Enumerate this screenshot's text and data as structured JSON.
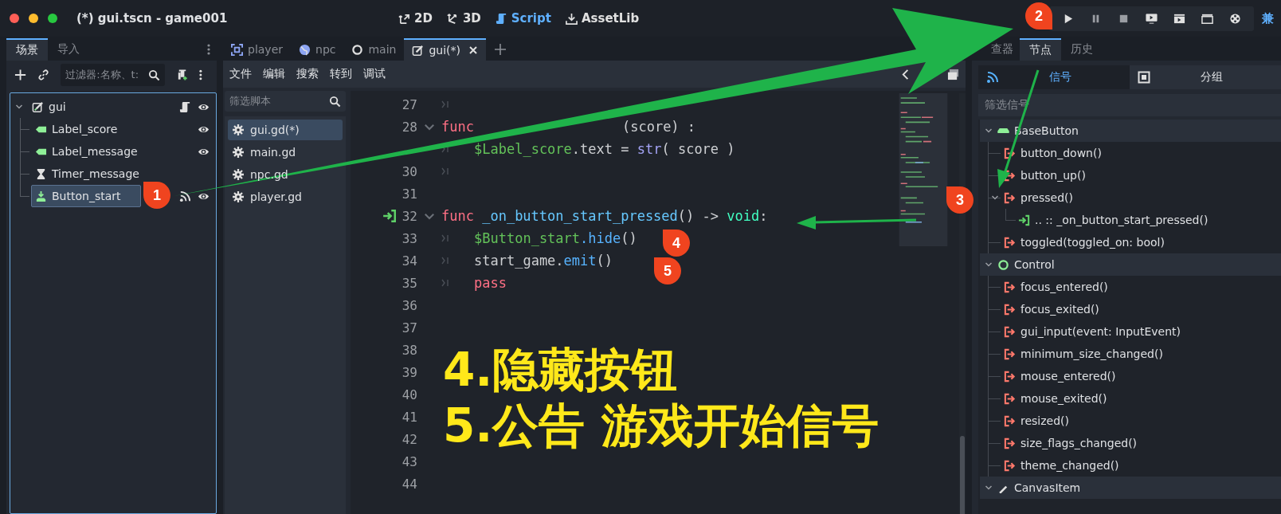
{
  "window": {
    "title": "(*) gui.tscn - game001"
  },
  "main_tabs": [
    {
      "label": "2D",
      "kind": "flat",
      "selected": false
    },
    {
      "label": "3D",
      "kind": "spatial",
      "selected": false
    },
    {
      "label": "Script",
      "kind": "script",
      "selected": true
    },
    {
      "label": "AssetLib",
      "kind": "assetlib",
      "selected": false
    }
  ],
  "renderer_label": "兼",
  "scene_dock": {
    "tabs": [
      {
        "label": "场景",
        "selected": true
      },
      {
        "label": "导入",
        "selected": false
      }
    ],
    "filter": {
      "placeholder": "过滤器:名称、t:"
    },
    "tree": {
      "label": "gui",
      "kind": "control",
      "selected": false,
      "script": true,
      "signals": false,
      "eye": true,
      "children": [
        {
          "label": "Label_score",
          "kind": "label",
          "selected": false,
          "script": false,
          "signals": false,
          "eye": true
        },
        {
          "label": "Label_message",
          "kind": "label",
          "selected": false,
          "script": false,
          "signals": false,
          "eye": true
        },
        {
          "label": "Timer_message",
          "kind": "timer",
          "selected": false,
          "script": false,
          "signals": false,
          "eye": false
        },
        {
          "label": "Button_start",
          "kind": "button",
          "selected": true,
          "script": false,
          "signals": true,
          "eye": true
        }
      ]
    }
  },
  "script_tabs": [
    {
      "label": "player",
      "kind": "node2d",
      "selected": false
    },
    {
      "label": "npc",
      "kind": "globe",
      "selected": false
    },
    {
      "label": "main",
      "kind": "node",
      "selected": false
    },
    {
      "label": "gui(*)",
      "kind": "control",
      "selected": true
    }
  ],
  "editor_menu": [
    "文件",
    "编辑",
    "搜索",
    "转到",
    "调试"
  ],
  "script_filter": {
    "placeholder": "筛选脚本"
  },
  "scripts": [
    {
      "name": "gui.gd(*)",
      "selected": true
    },
    {
      "name": "main.gd",
      "selected": false
    },
    {
      "name": "npc.gd",
      "selected": false
    },
    {
      "name": "player.gd",
      "selected": false
    }
  ],
  "code_lines": [
    {
      "number": "27",
      "fold": false,
      "connected": false,
      "tab": true
    },
    {
      "number": "28",
      "fold": true,
      "connected": false,
      "tab": false,
      "tokens": [
        {
          "kind": "keyword",
          "text": "func"
        },
        {
          "kind": "plain",
          "text": "(score) :",
          "after_gap": true
        }
      ]
    },
    {
      "fold": false,
      "connected": false,
      "tab": true,
      "tokens": [
        {
          "kind": "path",
          "text": "$Label_score"
        },
        {
          "kind": "plain",
          "text": ".text = "
        },
        {
          "kind": "builtin",
          "text": "str"
        },
        {
          "kind": "plain",
          "text": "( score )"
        }
      ]
    },
    {
      "number": "30",
      "fold": false,
      "connected": false,
      "tab": true
    },
    {
      "number": "31",
      "fold": false,
      "connected": false,
      "tab": false
    },
    {
      "number": "32",
      "fold": true,
      "connected": true,
      "tab": false,
      "tokens": [
        {
          "kind": "keyword",
          "text": "func"
        },
        {
          "kind": "function",
          "text": " _on_button_start_pressed"
        },
        {
          "kind": "plain",
          "text": "() -> "
        },
        {
          "kind": "type",
          "text": "void"
        },
        {
          "kind": "plain",
          "text": ":"
        }
      ]
    },
    {
      "number": "33",
      "fold": false,
      "connected": false,
      "tab": true,
      "tokens": [
        {
          "kind": "path",
          "text": "$Button_start"
        },
        {
          "kind": "method",
          "text": ".hide"
        },
        {
          "kind": "plain",
          "text": "()"
        }
      ]
    },
    {
      "number": "34",
      "fold": false,
      "connected": false,
      "tab": true,
      "tokens": [
        {
          "kind": "plain",
          "text": "start_game."
        },
        {
          "kind": "method",
          "text": "emit"
        },
        {
          "kind": "plain",
          "text": "()"
        }
      ]
    },
    {
      "number": "35",
      "fold": false,
      "connected": false,
      "tab": true,
      "tokens": [
        {
          "kind": "keyword",
          "text": "pass"
        }
      ]
    },
    {
      "number": "36",
      "fold": false,
      "connected": false,
      "tab": false
    },
    {
      "number": "37",
      "fold": false,
      "connected": false,
      "tab": false
    },
    {
      "number": "38",
      "fold": false,
      "connected": false,
      "tab": false
    },
    {
      "number": "39",
      "fold": false,
      "connected": false,
      "tab": false
    },
    {
      "number": "40",
      "fold": false,
      "connected": false,
      "tab": false
    },
    {
      "number": "41",
      "fold": false,
      "connected": false,
      "tab": false
    },
    {
      "number": "42",
      "fold": false,
      "connected": false,
      "tab": false
    },
    {
      "number": "43",
      "fold": false,
      "connected": false,
      "tab": false
    },
    {
      "number": "44",
      "fold": false,
      "connected": false,
      "tab": false
    }
  ],
  "inspector_tabs": [
    {
      "label": "查器",
      "selected": false
    },
    {
      "label": "节点",
      "selected": true
    },
    {
      "label": "历史",
      "selected": false
    }
  ],
  "node_tabs": [
    {
      "label": "信号",
      "kind": "signals",
      "selected": true
    },
    {
      "label": "分组",
      "kind": "groups",
      "selected": false
    }
  ],
  "signal_filter": {
    "placeholder": "筛选信号"
  },
  "signal_groups": [
    {
      "name": "BaseButton",
      "kind": "button",
      "expanded": true,
      "signals": [
        {
          "name": "button_down()"
        },
        {
          "name": "button_up()"
        },
        {
          "name": "pressed()",
          "expanded": true,
          "children": [
            ".. :: _on_button_start_pressed()"
          ]
        },
        {
          "name": "toggled(toggled_on: bool)"
        }
      ]
    },
    {
      "name": "Control",
      "kind": "control",
      "expanded": true,
      "signals": [
        {
          "name": "focus_entered()"
        },
        {
          "name": "focus_exited()"
        },
        {
          "name": "gui_input(event: InputEvent)"
        },
        {
          "name": "minimum_size_changed()"
        },
        {
          "name": "mouse_entered()"
        },
        {
          "name": "mouse_exited()"
        },
        {
          "name": "resized()"
        },
        {
          "name": "size_flags_changed()"
        },
        {
          "name": "theme_changed()"
        }
      ]
    },
    {
      "name": "CanvasItem",
      "kind": "canvas",
      "expanded": true
    }
  ],
  "annotations": {
    "badges": [
      {
        "label": "1",
        "kind": "left"
      },
      {
        "label": "2",
        "kind": "down"
      },
      {
        "label": "3",
        "kind": "left"
      },
      {
        "label": "4",
        "kind": "left"
      },
      {
        "label": "5",
        "kind": "left"
      }
    ],
    "captions": [
      "4.隐藏按钮",
      "5.公告 游戏开始信号"
    ]
  }
}
